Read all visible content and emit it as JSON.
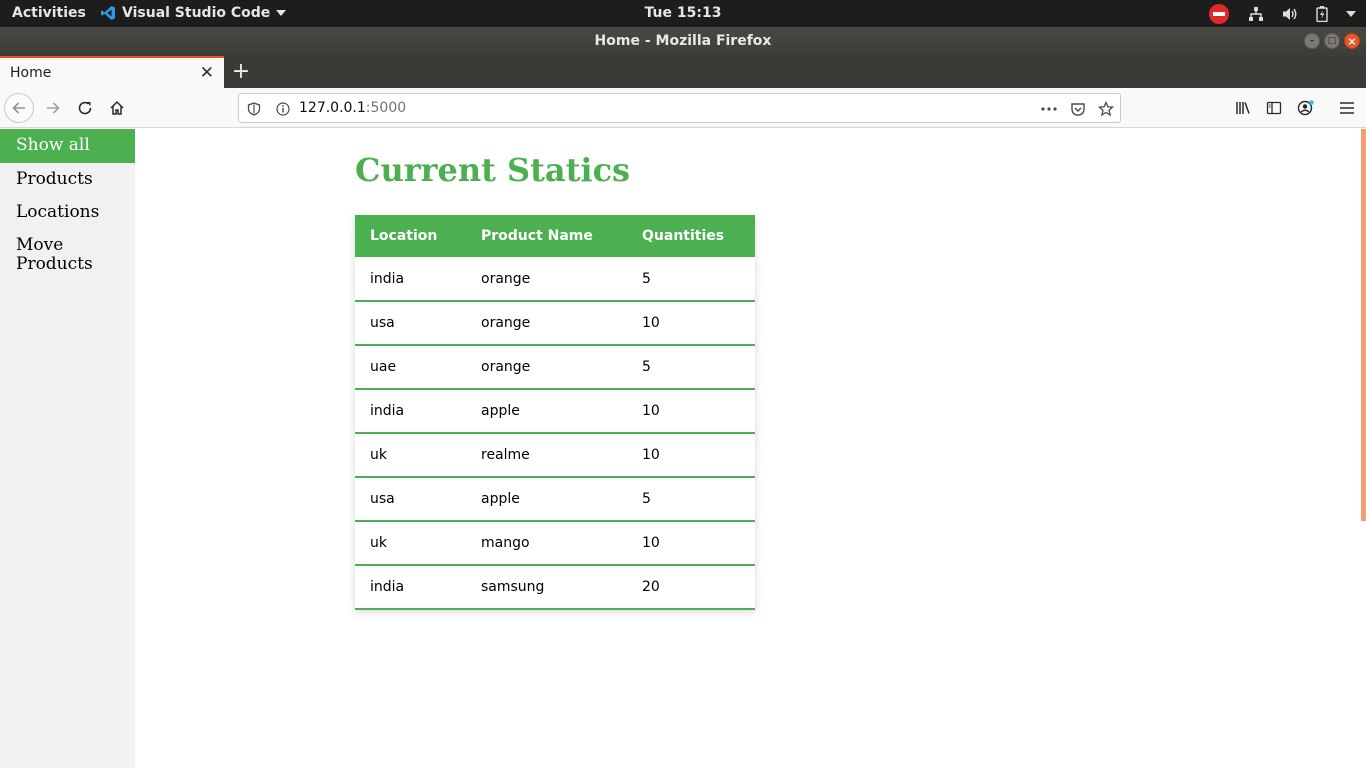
{
  "system_bar": {
    "activities": "Activities",
    "app_name": "Visual Studio Code",
    "clock": "Tue 15:13"
  },
  "window": {
    "title": "Home - Mozilla Firefox"
  },
  "browser": {
    "tab_title": "Home",
    "url_host": "127.0.0.1",
    "url_port": ":5000"
  },
  "sidebar": {
    "items": [
      {
        "label": "Show all",
        "active": true
      },
      {
        "label": "Products",
        "active": false
      },
      {
        "label": "Locations",
        "active": false
      },
      {
        "label": "Move Products",
        "active": false
      }
    ]
  },
  "main": {
    "title": "Current Statics",
    "table": {
      "headers": [
        "Location",
        "Product Name",
        "Quantities"
      ],
      "rows": [
        [
          "india",
          "orange",
          "5"
        ],
        [
          "usa",
          "orange",
          "10"
        ],
        [
          "uae",
          "orange",
          "5"
        ],
        [
          "india",
          "apple",
          "10"
        ],
        [
          "uk",
          "realme",
          "10"
        ],
        [
          "usa",
          "apple",
          "5"
        ],
        [
          "uk",
          "mango",
          "10"
        ],
        [
          "india",
          "samsung",
          "20"
        ]
      ]
    }
  },
  "colors": {
    "accent": "#4caf50",
    "ubuntu_orange": "#e95420",
    "panel": "#1d1d1d"
  }
}
